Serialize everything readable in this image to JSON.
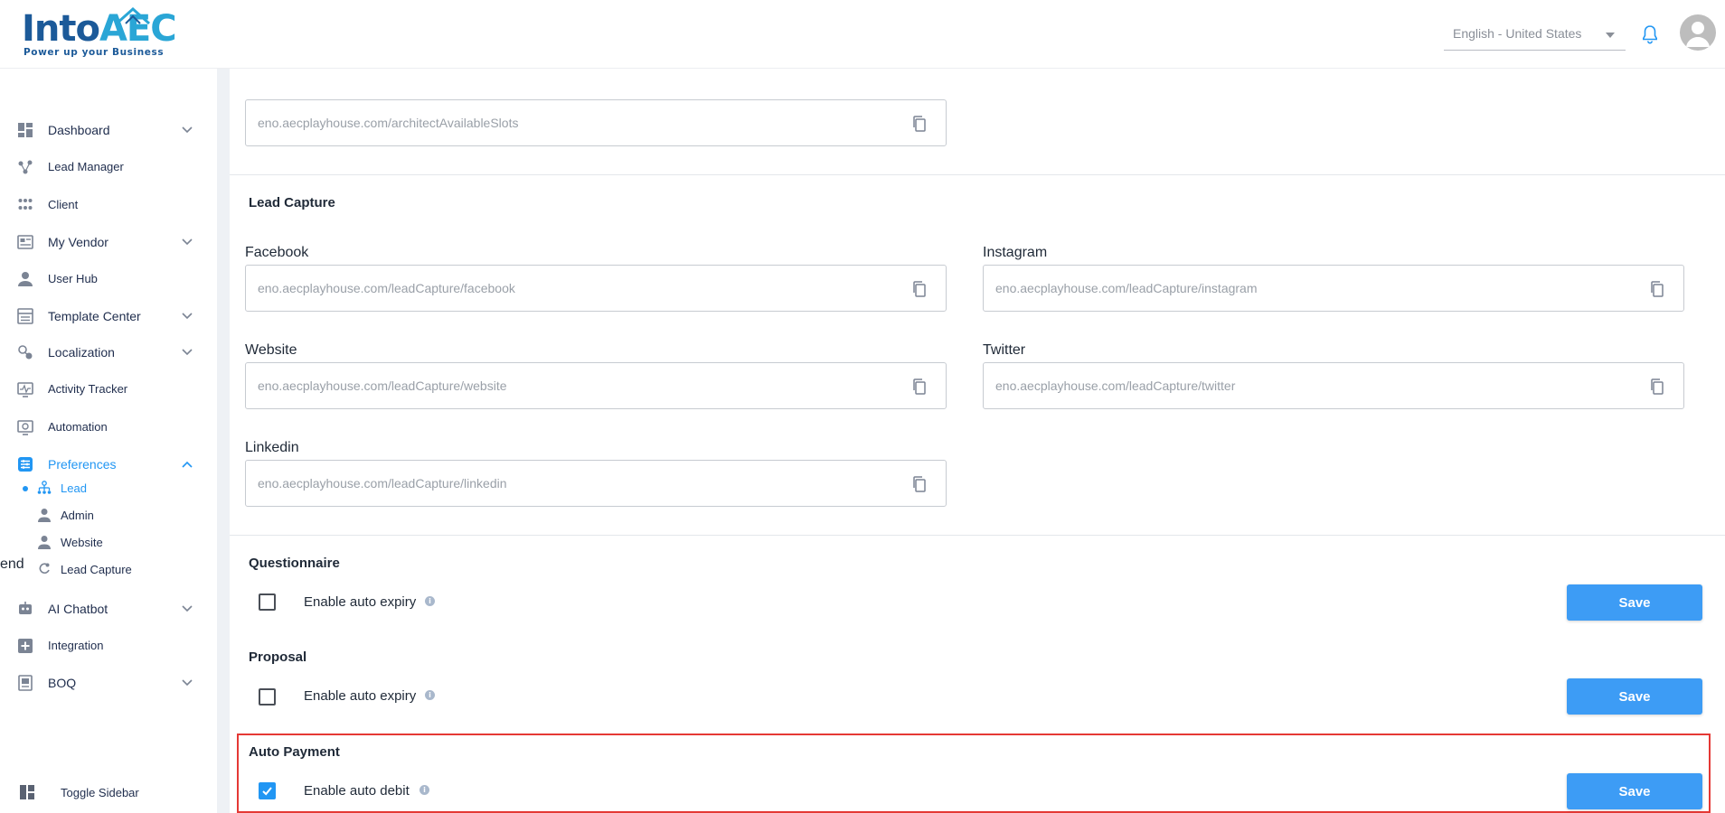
{
  "header": {
    "logo_main": "Into",
    "logo_accent": "AEC",
    "logo_tagline": "Power up your Business",
    "language": "English - United States"
  },
  "sidebar": {
    "items": [
      {
        "label": "Dashboard",
        "icon": "dashboard-icon",
        "has_chevron": true
      },
      {
        "label": "Lead Manager",
        "icon": "lead-manager-icon",
        "has_chevron": false
      },
      {
        "label": "Client",
        "icon": "client-icon",
        "has_chevron": false
      },
      {
        "label": "My Vendor",
        "icon": "vendor-icon",
        "has_chevron": true
      },
      {
        "label": "User Hub",
        "icon": "user-icon",
        "has_chevron": false
      },
      {
        "label": "Template Center",
        "icon": "template-icon",
        "has_chevron": true
      },
      {
        "label": "Localization",
        "icon": "localization-icon",
        "has_chevron": true
      },
      {
        "label": "Activity Tracker",
        "icon": "activity-icon",
        "has_chevron": false
      },
      {
        "label": "Automation",
        "icon": "automation-icon",
        "has_chevron": false
      },
      {
        "label": "Preferences",
        "icon": "preferences-icon",
        "has_chevron": true,
        "active": true
      },
      {
        "label": "AI Chatbot",
        "icon": "chatbot-icon",
        "has_chevron": true
      },
      {
        "label": "Integration",
        "icon": "integration-icon",
        "has_chevron": false
      },
      {
        "label": "BOQ",
        "icon": "boq-icon",
        "has_chevron": true
      }
    ],
    "sub_items": [
      {
        "label": "Lead",
        "icon": "lead-tree-icon",
        "active": true
      },
      {
        "label": "Admin",
        "icon": "admin-icon"
      },
      {
        "label": "Website",
        "icon": "website-icon"
      },
      {
        "label": "Lead Capture",
        "icon": "lead-capture-icon"
      }
    ],
    "toggle_label": "Toggle Sidebar"
  },
  "main": {
    "architect_url": "eno.aecplayhouse.com/architectAvailableSlots",
    "lead_capture": {
      "title": "Lead Capture",
      "fields": {
        "facebook": {
          "label": "Facebook",
          "url": "eno.aecplayhouse.com/leadCapture/facebook"
        },
        "instagram": {
          "label": "Instagram",
          "url": "eno.aecplayhouse.com/leadCapture/instagram"
        },
        "website": {
          "label": "Website",
          "url": "eno.aecplayhouse.com/leadCapture/website"
        },
        "twitter": {
          "label": "Twitter",
          "url": "eno.aecplayhouse.com/leadCapture/twitter"
        },
        "linkedin": {
          "label": "Linkedin",
          "url": "eno.aecplayhouse.com/leadCapture/linkedin"
        }
      }
    },
    "questionnaire": {
      "title": "Questionnaire",
      "checkbox_label": "Enable auto expiry",
      "checked": false,
      "save_label": "Save"
    },
    "proposal": {
      "title": "Proposal",
      "checkbox_label": "Enable auto expiry",
      "checked": false,
      "save_label": "Save"
    },
    "auto_payment": {
      "title": "Auto Payment",
      "checkbox_label": "Enable auto debit",
      "checked": true,
      "save_label": "Save"
    },
    "colors": {
      "accent": "#2196f3",
      "button": "#3d9cf5",
      "highlight": "#e53935"
    }
  }
}
